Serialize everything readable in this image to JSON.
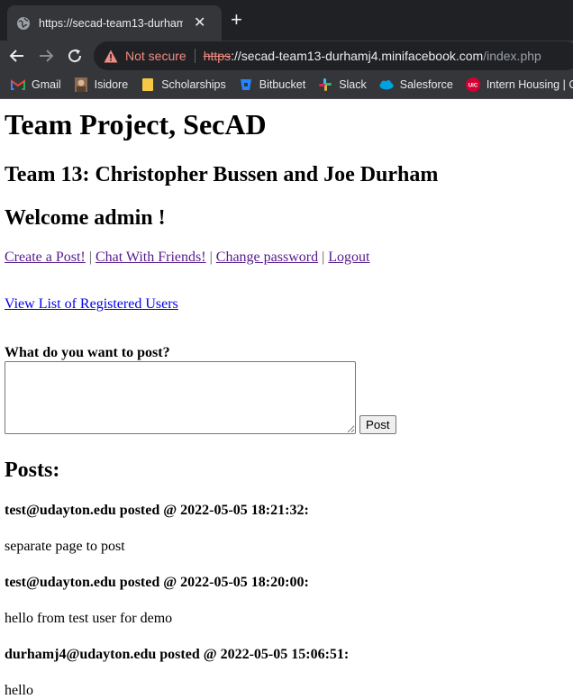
{
  "browser": {
    "tab_title": "https://secad-team13-durhamj4.minifacebook.com/index.php",
    "tab_display": "https://secad-team13-durhamj4.m",
    "security_label": "Not secure",
    "url_scheme": "https",
    "url_sep": "://",
    "url_host": "secad-team13-durhamj4.minifacebook.com",
    "url_path": "/index.php",
    "bookmarks": [
      {
        "label": "Gmail",
        "icon": "gmail-icon"
      },
      {
        "label": "Isidore",
        "icon": "isidore-icon"
      },
      {
        "label": "Scholarships",
        "icon": "folder-icon"
      },
      {
        "label": "Bitbucket",
        "icon": "bitbucket-icon"
      },
      {
        "label": "Slack",
        "icon": "slack-icon"
      },
      {
        "label": "Salesforce",
        "icon": "salesforce-icon"
      },
      {
        "label": "Intern Housing | C",
        "icon": "uic-icon"
      }
    ]
  },
  "page": {
    "title": "Team Project, SecAD",
    "team": "Team 13: Christopher Bussen and Joe Durham",
    "welcome": "Welcome admin !",
    "links": {
      "create_post": "Create a Post!",
      "chat": "Chat With Friends!",
      "change_password": "Change password",
      "logout": "Logout",
      "separator": "|"
    },
    "users_link": "View List of Registered Users",
    "post_prompt": "What do you want to post?",
    "post_value": "",
    "post_button": "Post",
    "posts_heading": "Posts:",
    "posts": [
      {
        "header": "test@udayton.edu posted @ 2022-05-05 18:21:32:",
        "body": "separate page to post"
      },
      {
        "header": "test@udayton.edu posted @ 2022-05-05 18:20:00:",
        "body": "hello from test user for demo"
      },
      {
        "header": "durhamj4@udayton.edu posted @ 2022-05-05 15:06:51:",
        "body": "hello"
      }
    ]
  }
}
